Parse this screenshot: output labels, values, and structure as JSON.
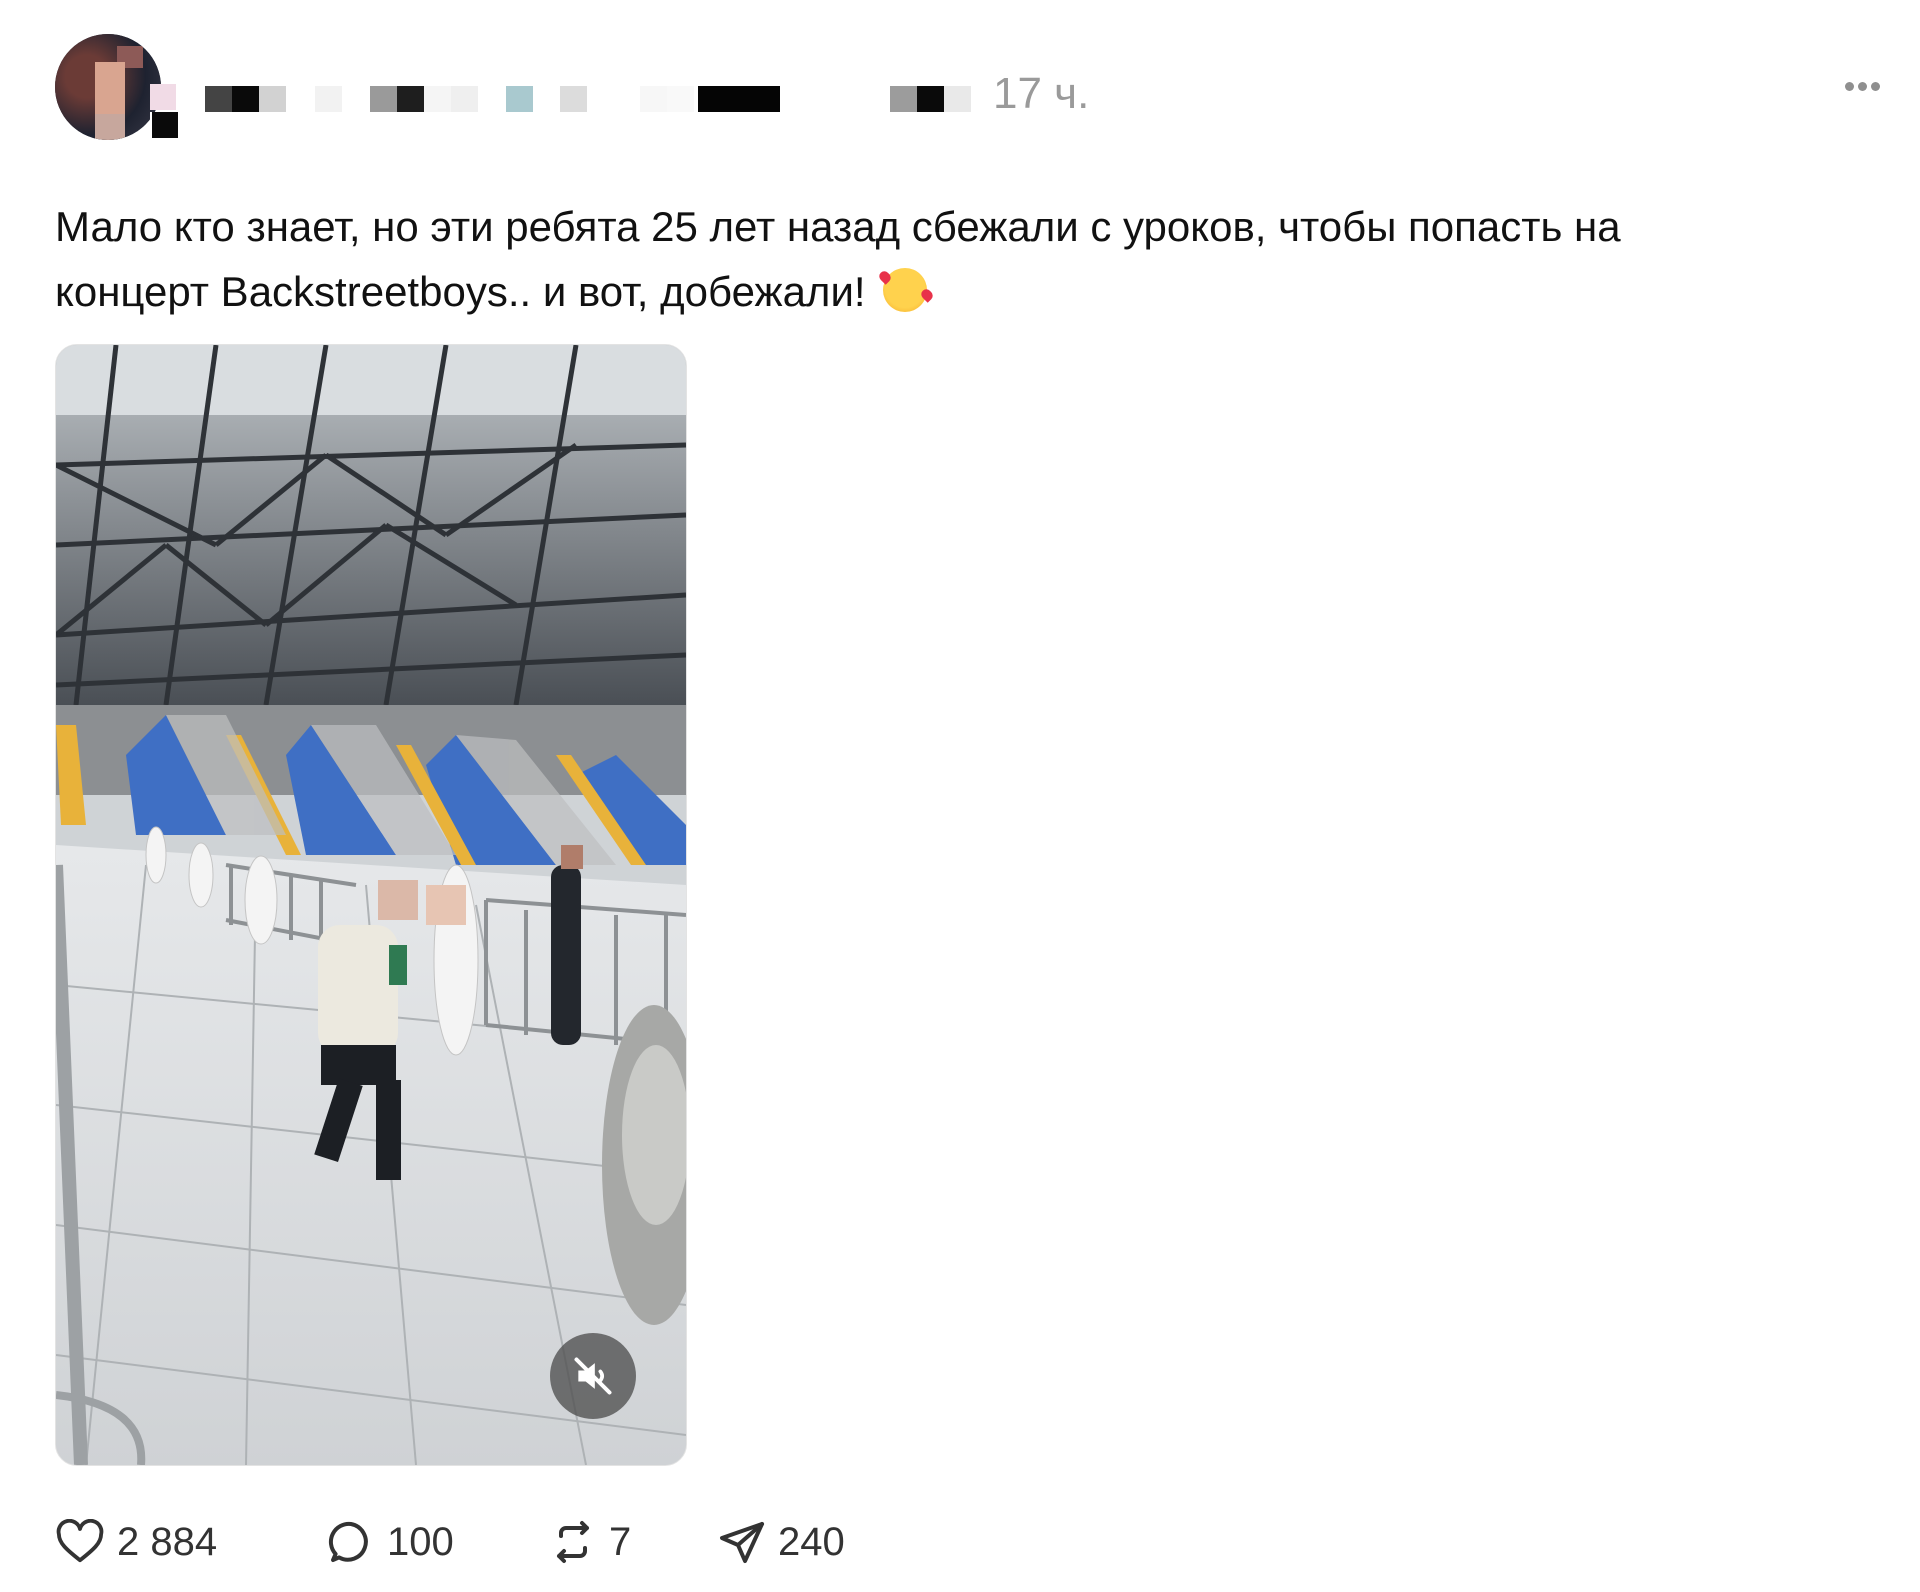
{
  "post": {
    "time": "17 ч.",
    "text_line1": "Мало кто знает, но эти ребята 25 лет назад сбежали с уроков, чтобы попасть на",
    "text_line2": "концерт Backstreetboys.. и вот, добежали! "
  },
  "actions": {
    "likes": "2 884",
    "comments": "100",
    "reposts": "7",
    "shares": "240"
  },
  "video": {
    "muted": true
  },
  "colors": {
    "text": "#111111",
    "muted_text": "#9a9a9a",
    "icon": "#333333",
    "seat_blue": "#3f6fc4",
    "seat_yellow": "#e8b23a"
  },
  "icons": {
    "more": "more-horizontal-icon",
    "like": "heart-icon",
    "comment": "comment-bubble-icon",
    "repost": "repost-icon",
    "share": "paper-plane-icon",
    "mute": "speaker-muted-icon",
    "emoji": "smiling-face-with-hearts-icon"
  }
}
